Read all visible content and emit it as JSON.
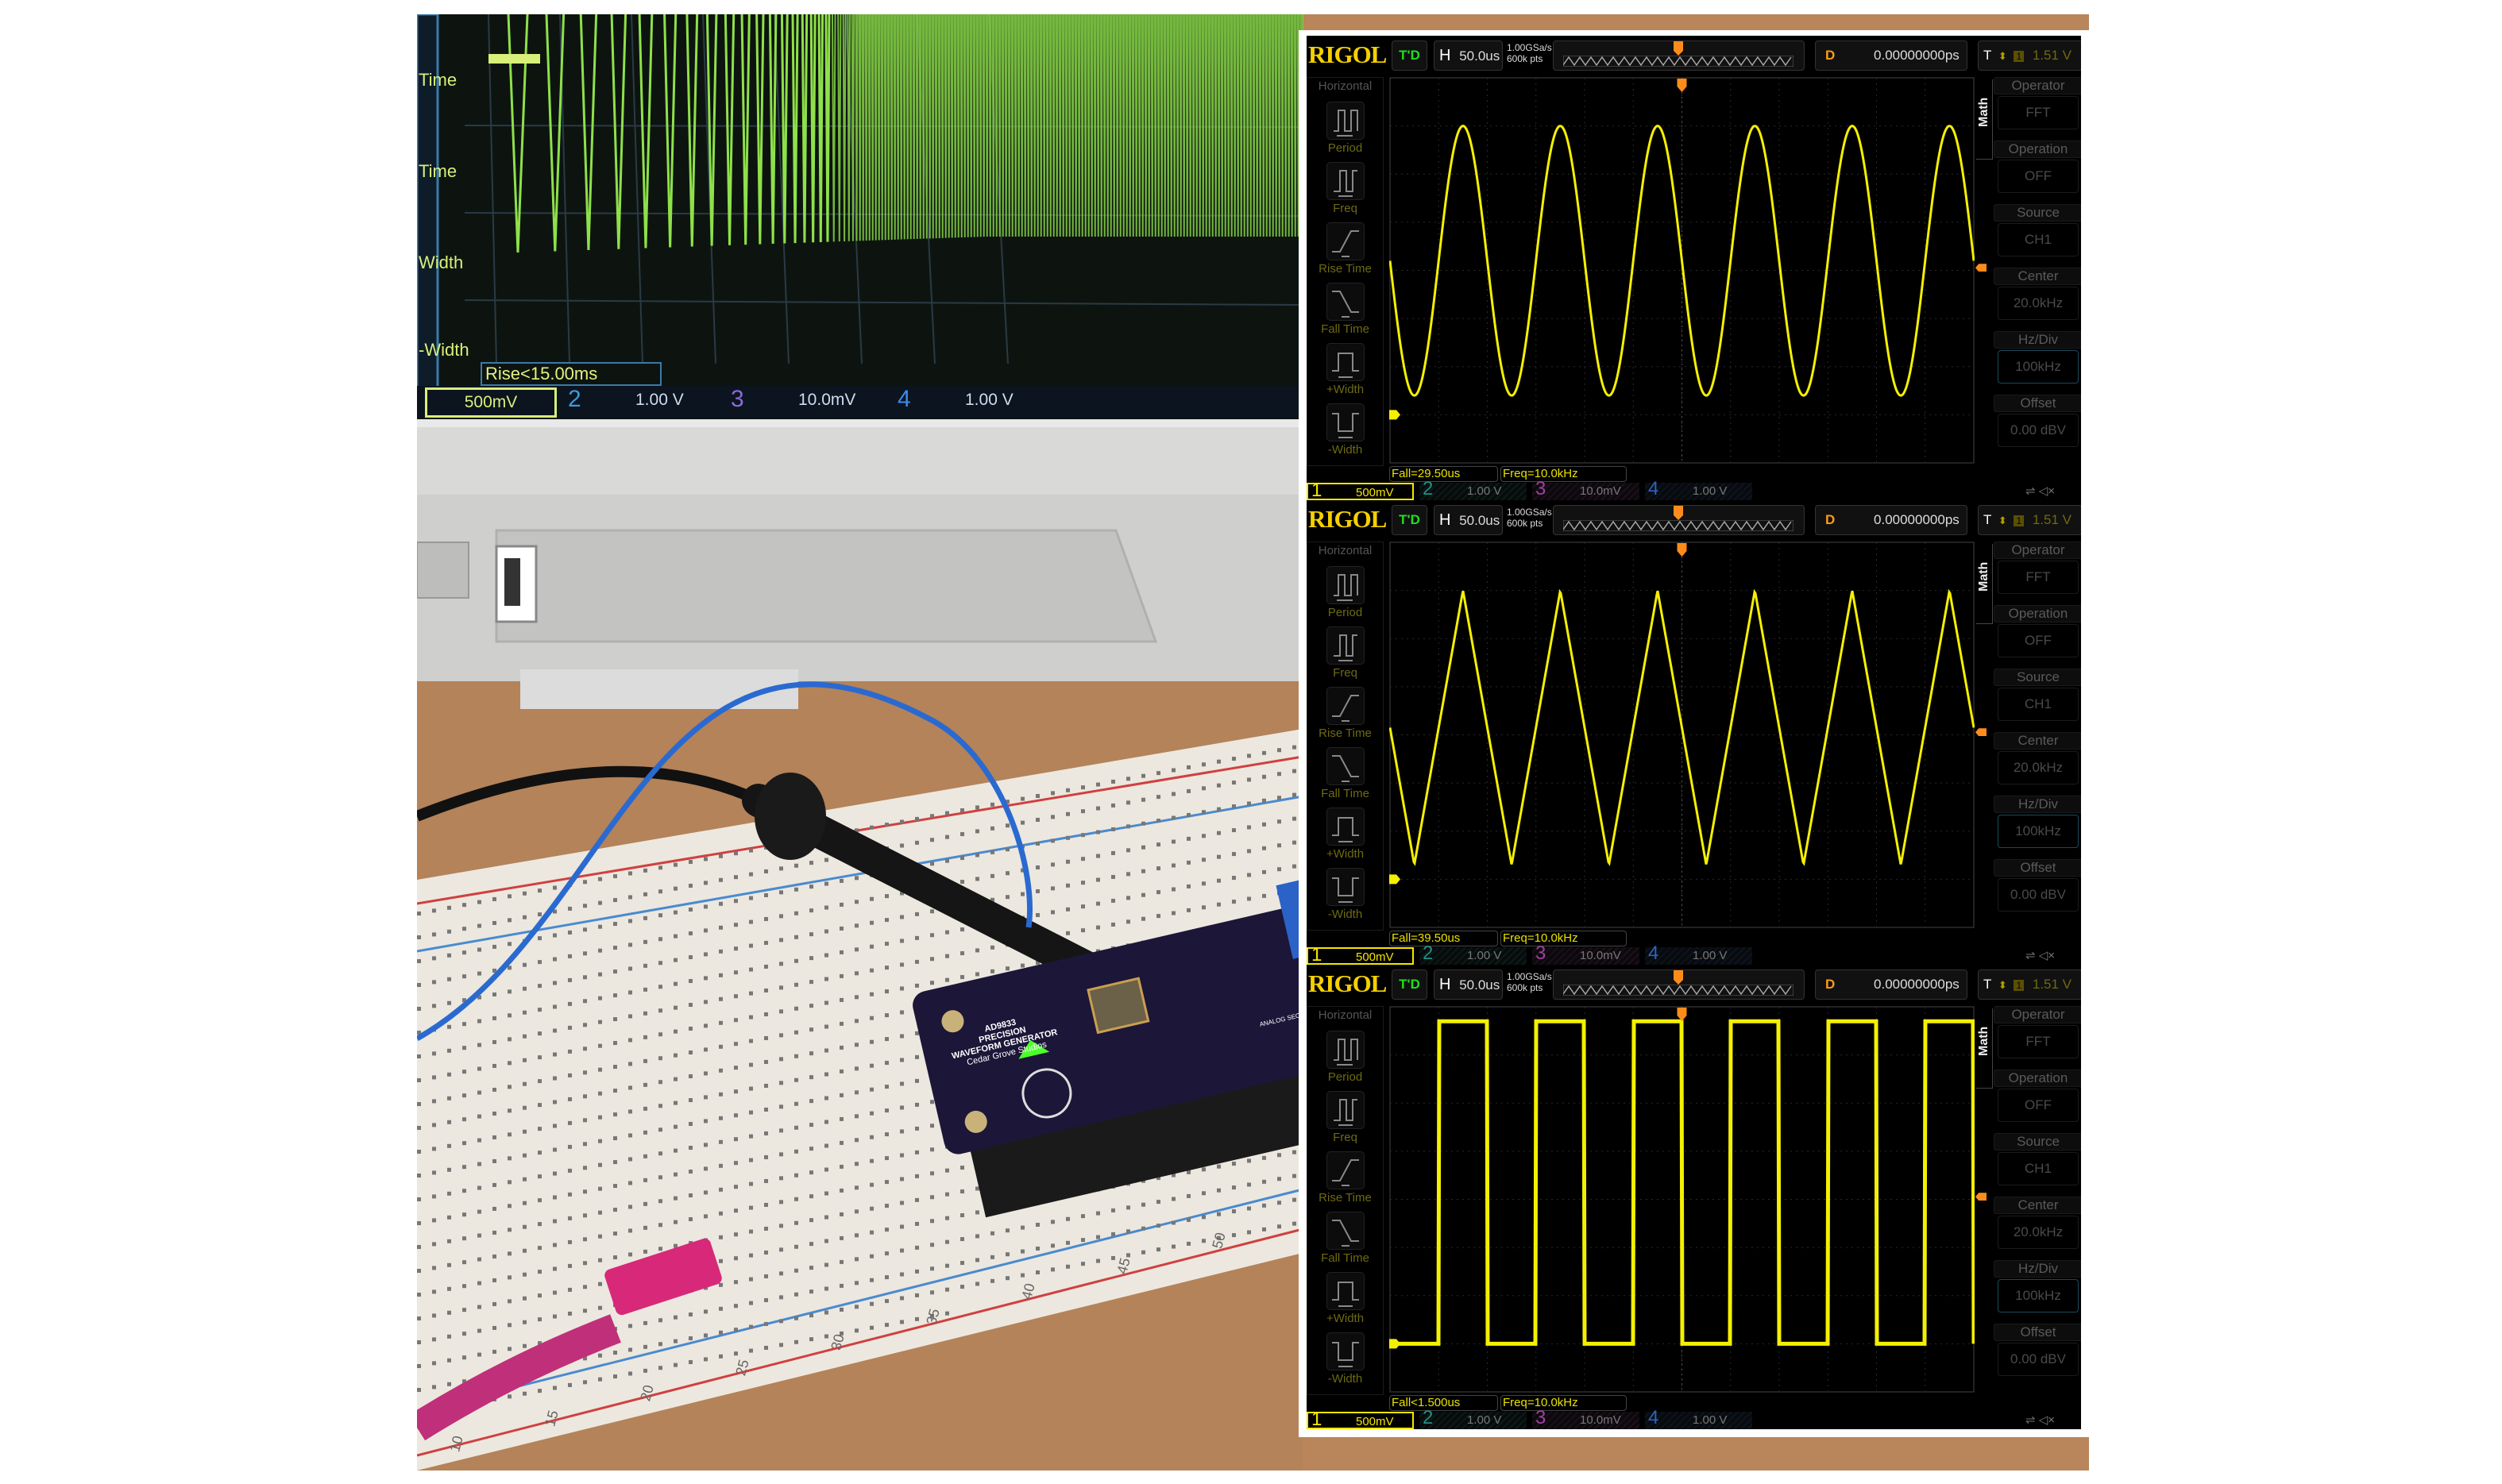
{
  "photo": {
    "scope_screen": {
      "menu_labels": [
        "Time",
        "Time",
        "Width",
        "-Width"
      ],
      "measurement": "Rise<15.00ms",
      "channels": [
        {
          "num": "1",
          "scale": "500mV"
        },
        {
          "num": "2",
          "scale": "1.00 V"
        },
        {
          "num": "3",
          "scale": "10.0mV"
        },
        {
          "num": "4",
          "scale": "1.00 V"
        }
      ],
      "trace_color": "#8fe04a"
    },
    "pcb": {
      "title_lines": [
        "AD9833",
        "PRECISION",
        "WAVEFORM GENERATOR"
      ],
      "maker": "Cedar Grove Studios",
      "section_label": "ANALOG SECTION"
    },
    "breadboard_numbers": [
      "10",
      "15",
      "20",
      "25",
      "30",
      "35",
      "40",
      "45",
      "50"
    ]
  },
  "scope_common": {
    "logo": "RIGOL",
    "trigger_status": "T'D",
    "timebase_label": "H",
    "timebase": "50.0us",
    "sample_rate": "1.00GSa/s",
    "memory_depth": "600k pts",
    "delay_label": "D",
    "delay": "0.00000000ps",
    "trigger_label": "T",
    "trigger_channel": "1",
    "trigger_level": "1.51 V",
    "left_menu_title": "Horizontal",
    "left_menu": [
      {
        "label": "Period",
        "icon": "period-icon"
      },
      {
        "label": "Freq",
        "icon": "frequency-icon"
      },
      {
        "label": "Rise Time",
        "icon": "rise-time-icon"
      },
      {
        "label": "Fall Time",
        "icon": "fall-time-icon"
      },
      {
        "label": "+Width",
        "icon": "positive-width-icon"
      },
      {
        "label": "-Width",
        "icon": "negative-width-icon"
      }
    ],
    "math_tab": "Math",
    "right_menu": [
      {
        "title": "Operator",
        "value": "FFT"
      },
      {
        "title": "Operation",
        "value": "OFF"
      },
      {
        "title": "Source",
        "value": "CH1"
      },
      {
        "title": "Center",
        "value": "20.0kHz"
      },
      {
        "title": "Hz/Div",
        "value": "100kHz"
      },
      {
        "title": "Offset",
        "value": "0.00 dBV"
      }
    ],
    "channels": [
      {
        "num": "1",
        "scale": "500mV",
        "color": "#f5e600"
      },
      {
        "num": "2",
        "scale": "1.00 V",
        "color": "#1f8f86"
      },
      {
        "num": "3",
        "scale": "10.0mV",
        "color": "#a040a0"
      },
      {
        "num": "4",
        "scale": "1.00 V",
        "color": "#2b64c0"
      }
    ],
    "trace_color": "#f5f000",
    "trigger_color": "#ff8c1a"
  },
  "panels": [
    {
      "waveform": "sine",
      "frequency_khz": 10.0,
      "vmin_v": 0.2,
      "vmax_v": 3.0,
      "measurements": [
        "Fall=29.50us",
        "Freq=10.0kHz"
      ]
    },
    {
      "waveform": "triangle",
      "frequency_khz": 10.0,
      "vmin_v": 0.15,
      "vmax_v": 3.0,
      "measurements": [
        "Fall=39.50us",
        "Freq=10.0kHz"
      ]
    },
    {
      "waveform": "square",
      "frequency_khz": 10.0,
      "vmin_v": 0.0,
      "vmax_v": 3.35,
      "measurements": [
        "Fall<1.500us",
        "Freq=10.0kHz"
      ]
    }
  ]
}
